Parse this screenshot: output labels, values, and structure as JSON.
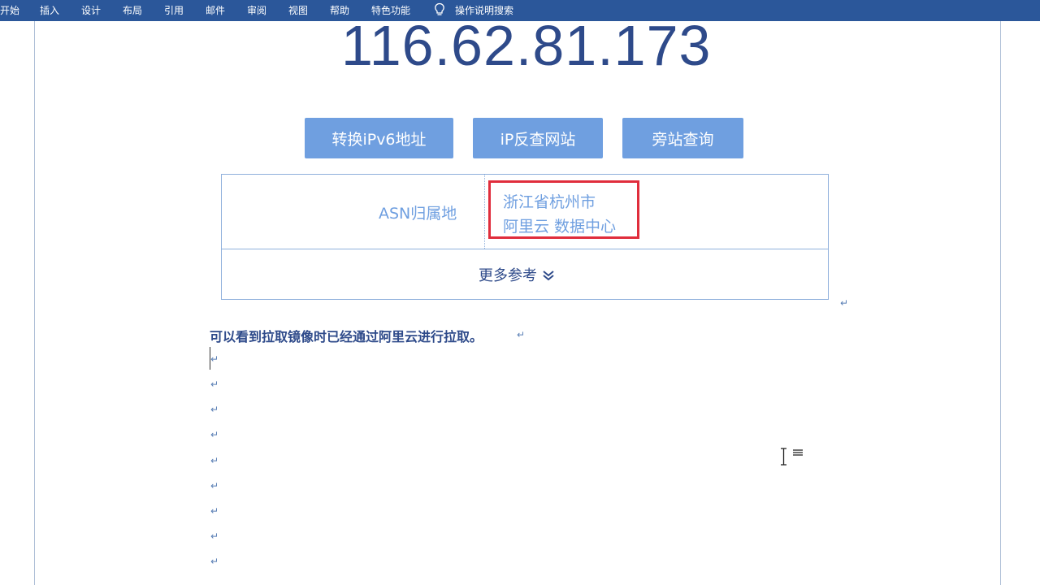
{
  "ribbon": {
    "tabs": [
      "开始",
      "插入",
      "设计",
      "布局",
      "引用",
      "邮件",
      "审阅",
      "视图",
      "帮助",
      "特色功能"
    ],
    "search_label": "操作说明搜索"
  },
  "document": {
    "ip_address": "116.62.81.173",
    "buttons": [
      "转换iPv6地址",
      "iP反查网站",
      "旁站查询"
    ],
    "table": {
      "asn_label": "ASN归属地",
      "asn_value_line1": "浙江省杭州市",
      "asn_value_line2": "阿里云 数据中心",
      "more_label": "更多参考"
    },
    "body_text": "可以看到拉取镜像时已经通过阿里云进行拉取。",
    "paragraph_mark": "↵"
  },
  "colors": {
    "ribbon_bg": "#2b579a",
    "button_bg": "#6f9fe0",
    "highlight_border": "#e02d3c",
    "text_dark_blue": "#2e4a8a"
  }
}
